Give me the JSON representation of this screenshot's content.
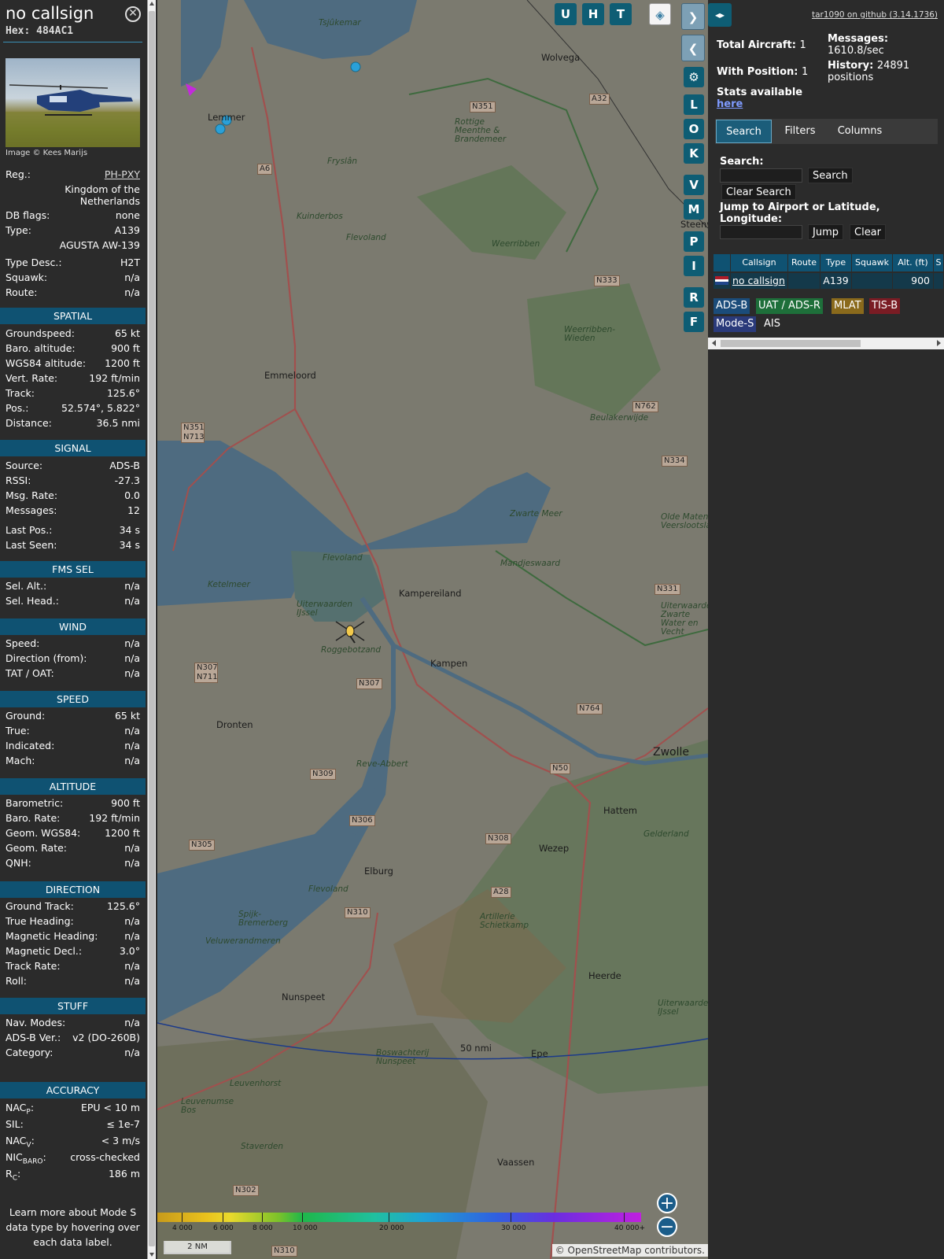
{
  "infobox": {
    "callsign": "no callsign",
    "hex_label": "Hex:",
    "hex": "484AC1",
    "photo_credit": "Image © Kees Marijs",
    "rows_top": [
      {
        "label": "Reg.:",
        "value": "PH-PXY"
      },
      {
        "label": "",
        "value": "Kingdom of the Netherlands"
      },
      {
        "label": "DB flags:",
        "value": "none"
      },
      {
        "label": "Type:",
        "value": "A139"
      },
      {
        "label": "",
        "value": "AGUSTA AW-139"
      },
      {
        "label": "Type Desc.:",
        "value": "H2T"
      },
      {
        "label": "Squawk:",
        "value": "n/a"
      },
      {
        "label": "Route:",
        "value": "n/a"
      }
    ],
    "spatial": {
      "title": "SPATIAL",
      "rows": [
        {
          "label": "Groundspeed:",
          "value": "65 kt"
        },
        {
          "label": "Baro. altitude:",
          "value": "900 ft"
        },
        {
          "label": "WGS84 altitude:",
          "value": "1200 ft"
        },
        {
          "label": "Vert. Rate:",
          "value": "192 ft/min"
        },
        {
          "label": "Track:",
          "value": "125.6°"
        },
        {
          "label": "Pos.:",
          "value": "52.574°, 5.822°"
        },
        {
          "label": "Distance:",
          "value": "36.5 nmi"
        }
      ]
    },
    "signal": {
      "title": "SIGNAL",
      "rows": [
        {
          "label": "Source:",
          "value": "ADS-B"
        },
        {
          "label": "RSSI:",
          "value": "-27.3"
        },
        {
          "label": "Msg. Rate:",
          "value": "0.0"
        },
        {
          "label": "Messages:",
          "value": "12"
        },
        {
          "label": "Last Pos.:",
          "value": "34 s"
        },
        {
          "label": "Last Seen:",
          "value": "34 s"
        }
      ]
    },
    "fms": {
      "title": "FMS SEL",
      "rows": [
        {
          "label": "Sel. Alt.:",
          "value": "n/a"
        },
        {
          "label": "Sel. Head.:",
          "value": "n/a"
        }
      ]
    },
    "wind": {
      "title": "WIND",
      "rows": [
        {
          "label": "Speed:",
          "value": "n/a"
        },
        {
          "label": "Direction (from):",
          "value": "n/a"
        },
        {
          "label": "TAT / OAT:",
          "value": "n/a"
        }
      ]
    },
    "speed": {
      "title": "SPEED",
      "rows": [
        {
          "label": "Ground:",
          "value": "65 kt"
        },
        {
          "label": "True:",
          "value": "n/a"
        },
        {
          "label": "Indicated:",
          "value": "n/a"
        },
        {
          "label": "Mach:",
          "value": "n/a"
        }
      ]
    },
    "altitude": {
      "title": "ALTITUDE",
      "rows": [
        {
          "label": "Barometric:",
          "value": "900 ft"
        },
        {
          "label": "Baro. Rate:",
          "value": "192 ft/min"
        },
        {
          "label": "Geom. WGS84:",
          "value": "1200 ft"
        },
        {
          "label": "Geom. Rate:",
          "value": "n/a"
        },
        {
          "label": "QNH:",
          "value": "n/a"
        }
      ]
    },
    "direction": {
      "title": "DIRECTION",
      "rows": [
        {
          "label": "Ground Track:",
          "value": "125.6°"
        },
        {
          "label": "True Heading:",
          "value": "n/a"
        },
        {
          "label": "Magnetic Heading:",
          "value": "n/a"
        },
        {
          "label": "Magnetic Decl.:",
          "value": "3.0°"
        },
        {
          "label": "Track Rate:",
          "value": "n/a"
        },
        {
          "label": "Roll:",
          "value": "n/a"
        }
      ]
    },
    "stuff": {
      "title": "STUFF",
      "rows": [
        {
          "label": "Nav. Modes:",
          "value": "n/a"
        },
        {
          "label": "ADS-B Ver.:",
          "value": "v2 (DO-260B)"
        },
        {
          "label": "Category:",
          "value": "n/a"
        }
      ]
    },
    "accuracy": {
      "title": "ACCURACY",
      "rows": [
        {
          "label": "NAC",
          "sub": "P",
          "value": "EPU < 10 m"
        },
        {
          "label": "SIL:",
          "sub": "",
          "value": "≤ 1e-7"
        },
        {
          "label": "NAC",
          "sub": "V",
          "value": "< 3 m/s"
        },
        {
          "label": "NIC",
          "sub": "BARO",
          "value": "cross-checked"
        },
        {
          "label": "R",
          "sub": "C",
          "value": "186 m"
        }
      ]
    },
    "footer": "Learn more about Mode S data type by hovering over each data label."
  },
  "map": {
    "buttons_top": [
      "U",
      "H",
      "T"
    ],
    "buttons_side": [
      "L",
      "O",
      "K",
      "V",
      "M",
      "P",
      "I",
      "R",
      "F"
    ],
    "labels": {
      "tsjukemar": "Tsjûkemar",
      "wolvega": "Wolvega",
      "lemmer": "Lemmer",
      "rottige": "Rottige Meenthe & Brandemeer",
      "fryslan": "Fryslân",
      "kuinderbos": "Kuinderbos",
      "flevoland1": "Flevoland",
      "weerribben": "Weerribben",
      "steenw": "Steenw",
      "weerribben_wieden": "Weerribben-Wieden",
      "emmeloord": "Emmeloord",
      "beulakerwijde": "Beulakerwijde",
      "zwarte_meer": "Zwarte Meer",
      "oldemoten": "Olde Maten & Veerslootslanden",
      "mandjeswaard": "Mandjeswaard",
      "flevoland2": "Flevoland",
      "ketelmeer": "Ketelmeer",
      "kampereiland": "Kampereiland",
      "uiterwaarden": "Uiterwaarden IJssel",
      "roggebotzand": "Roggebotzand",
      "kampen": "Kampen",
      "uiterwaarden_zwarte": "Uiterwaarden Zwarte Water en Vecht",
      "dronten": "Dronten",
      "zwolle": "Zwolle",
      "reve_abbert": "Reve-Abbert",
      "hattem": "Hattem",
      "wezep": "Wezep",
      "elburg": "Elburg",
      "gelderland": "Gelderland",
      "artillerie": "Artillerie Schietkamp",
      "spijk": "Spijk-Bremerberg",
      "flevoland3": "Flevoland",
      "veluwerandmeren": "Veluwerandmeren",
      "heerde": "Heerde",
      "nunspeet": "Nunspeet",
      "uiterwaarden_ijssel2": "Uiterwaarden IJssel",
      "epe": "Epe",
      "roswachterij": "Boswachterij Nunspeet",
      "leuvenhorst": "Leuvenhorst",
      "leuvenumse": "Leuvenumse Bos",
      "staverden": "Staverden",
      "vaassen": "Vaassen",
      "range": "50 nmi"
    },
    "roads": [
      "N351",
      "A32",
      "A6",
      "N333",
      "N351 N713",
      "N762",
      "N334",
      "N331",
      "N307 N711",
      "N307",
      "N764",
      "N50",
      "N309",
      "N306",
      "N308",
      "N305",
      "A28",
      "N310",
      "N302",
      "N310"
    ],
    "colorbar_labels": [
      "4 000",
      "6 000",
      "8 000",
      "10 000",
      "20 000",
      "30 000",
      "40 000+"
    ],
    "scale": "2 NM",
    "attribution_prefix": "© ",
    "attribution_link": "OpenStreetMap",
    "attribution_suffix": " contributors."
  },
  "sidebar": {
    "version_link": "tar1090 on github (3.14.1736)",
    "total_label": "Total Aircraft:",
    "total_value": "1",
    "withpos_label": "With Position:",
    "withpos_value": "1",
    "messages_label": "Messages:",
    "messages_value": "1610.8/sec",
    "history_label": "History:",
    "history_value": "24891 positions",
    "stats_label": "Stats available",
    "stats_link": "here",
    "tabs": [
      "Search",
      "Filters",
      "Columns"
    ],
    "search_label": "Search:",
    "search_button": "Search",
    "clear_search_button": "Clear Search",
    "jump_label": "Jump to Airport or Latitude, Longitude:",
    "jump_button": "Jump",
    "clear_button": "Clear",
    "table_headers": [
      "",
      "Callsign",
      "Route",
      "Type",
      "Squawk",
      "Alt. (ft)",
      "S"
    ],
    "table_row": {
      "callsign": "no callsign",
      "route": "",
      "type": "A139",
      "squawk": "",
      "alt": "900"
    },
    "sources": [
      "ADS-B",
      "UAT / ADS-R",
      "MLAT",
      "TIS-B",
      "Mode-S",
      "AIS"
    ],
    "colors": {
      "adsb": "#1b4c7a",
      "uat": "#1e6f3a",
      "mlat": "#8a6a1c",
      "tisb": "#7a1c24",
      "modes": "#2a3a7a"
    }
  }
}
